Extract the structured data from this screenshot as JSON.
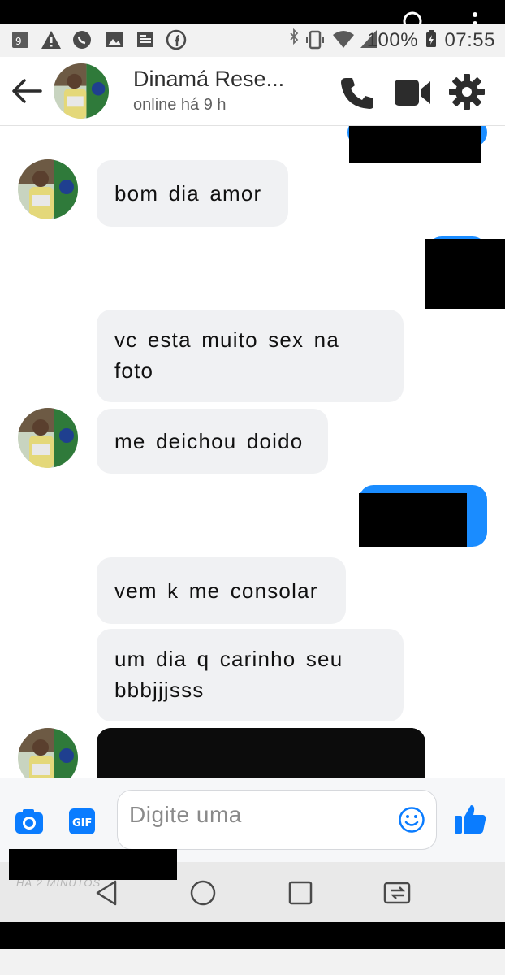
{
  "status_bar": {
    "battery": "100%",
    "time": "07:55"
  },
  "header": {
    "contact_name": "Dinamá Rese...",
    "contact_status": "online há 9 h"
  },
  "messages": [
    {
      "direction": "incoming",
      "text": "bom dia amor"
    },
    {
      "direction": "incoming",
      "text": "vc esta muito sex na foto"
    },
    {
      "direction": "incoming",
      "text": "me deichou doido"
    },
    {
      "direction": "incoming",
      "text": "vem k me consolar"
    },
    {
      "direction": "incoming",
      "text": "um dia q carinho seu bbbjjjsss"
    },
    {
      "direction": "incoming",
      "type": "image"
    }
  ],
  "composer": {
    "placeholder": "Digite uma"
  },
  "footer": {
    "ghost_text": "HÁ 2 MINUTOS"
  },
  "colors": {
    "accent": "#1a8cff",
    "incoming_bubble": "#f0f1f3",
    "icon_dark": "#2c2c2c"
  }
}
